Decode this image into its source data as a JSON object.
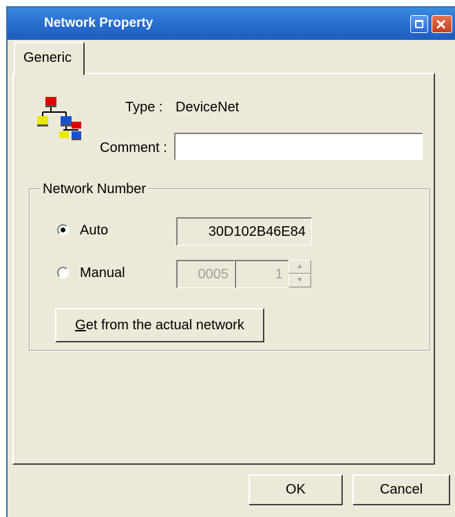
{
  "window": {
    "title": "Network Property"
  },
  "tabs": [
    {
      "label": "Generic"
    }
  ],
  "type_row": {
    "label": "Type :",
    "value": "DeviceNet"
  },
  "comment_row": {
    "label": "Comment :",
    "value": ""
  },
  "network_number": {
    "group_label": "Network Number",
    "auto": {
      "label": "Auto",
      "selected": true,
      "value": "30D102B46E84"
    },
    "manual": {
      "label": "Manual",
      "selected": false,
      "value": "0005",
      "node_value": "1"
    },
    "get_button_label": "Get from the actual network",
    "get_button_accel": "G",
    "get_button_rest": "et from the actual network"
  },
  "footer": {
    "ok_label": "OK",
    "cancel_label": "Cancel"
  },
  "icons": {
    "network": "network-icon",
    "maximize": "maximize-icon",
    "close": "close-icon",
    "spin_up": "arrow-up-icon",
    "spin_down": "arrow-down-icon"
  }
}
